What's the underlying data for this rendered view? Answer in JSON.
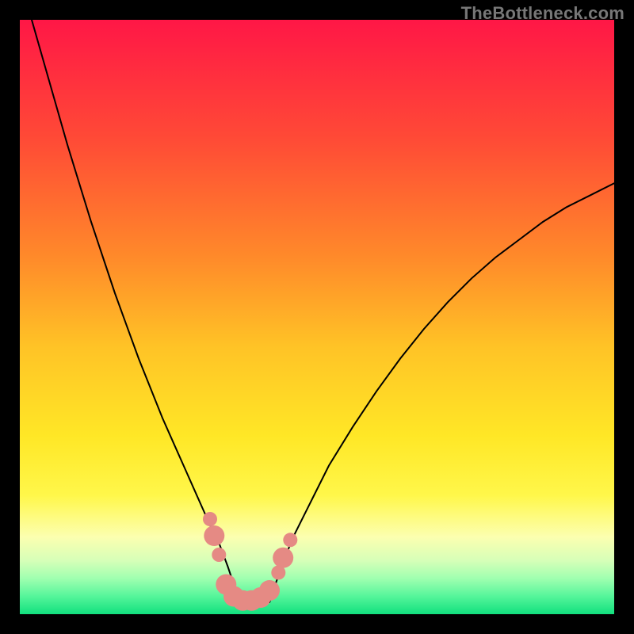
{
  "watermark": "TheBottleneck.com",
  "chart_data": {
    "type": "line",
    "title": "",
    "xlabel": "",
    "ylabel": "",
    "xlim": [
      0,
      100
    ],
    "ylim": [
      0,
      100
    ],
    "legend": false,
    "grid": false,
    "background": {
      "gradient_stops": [
        {
          "pos": 0.0,
          "color": "#ff1746"
        },
        {
          "pos": 0.2,
          "color": "#ff4a36"
        },
        {
          "pos": 0.4,
          "color": "#ff8a2a"
        },
        {
          "pos": 0.55,
          "color": "#ffc326"
        },
        {
          "pos": 0.7,
          "color": "#ffe726"
        },
        {
          "pos": 0.8,
          "color": "#fff74a"
        },
        {
          "pos": 0.87,
          "color": "#fcffb0"
        },
        {
          "pos": 0.91,
          "color": "#d6ffb8"
        },
        {
          "pos": 0.94,
          "color": "#9fffb0"
        },
        {
          "pos": 0.97,
          "color": "#55f59a"
        },
        {
          "pos": 1.0,
          "color": "#11e07e"
        }
      ]
    },
    "series": [
      {
        "name": "left-curve",
        "color": "#000000",
        "width": 2,
        "x": [
          2,
          4,
          6,
          8,
          10,
          12,
          14,
          16,
          18,
          20,
          22,
          24,
          26,
          28,
          30,
          32,
          33.5,
          35,
          37
        ],
        "values": [
          100,
          93,
          86,
          79,
          72.5,
          66,
          60,
          54,
          48.5,
          43,
          38,
          33,
          28.5,
          24,
          19.5,
          15,
          12,
          8,
          2
        ]
      },
      {
        "name": "right-curve",
        "color": "#000000",
        "width": 2,
        "x": [
          42,
          44,
          46,
          49,
          52,
          56,
          60,
          64,
          68,
          72,
          76,
          80,
          84,
          88,
          92,
          96,
          100
        ],
        "values": [
          2,
          8,
          13,
          19,
          25,
          31.5,
          37.5,
          43,
          48,
          52.5,
          56.5,
          60,
          63,
          66,
          68.5,
          70.5,
          72.5
        ]
      }
    ],
    "markers": {
      "name": "highlight-dots",
      "color": "#e58a84",
      "radius_small": 9,
      "radius_large": 13,
      "points": [
        {
          "x": 32.0,
          "y": 16.0,
          "r": "small"
        },
        {
          "x": 32.7,
          "y": 13.2,
          "r": "large"
        },
        {
          "x": 33.5,
          "y": 10.0,
          "r": "small"
        },
        {
          "x": 34.7,
          "y": 5.0,
          "r": "large"
        },
        {
          "x": 36.0,
          "y": 3.0,
          "r": "large"
        },
        {
          "x": 37.5,
          "y": 2.3,
          "r": "large"
        },
        {
          "x": 39.0,
          "y": 2.3,
          "r": "large"
        },
        {
          "x": 40.5,
          "y": 2.8,
          "r": "large"
        },
        {
          "x": 42.0,
          "y": 4.0,
          "r": "large"
        },
        {
          "x": 43.5,
          "y": 7.0,
          "r": "small"
        },
        {
          "x": 44.3,
          "y": 9.5,
          "r": "large"
        },
        {
          "x": 45.5,
          "y": 12.5,
          "r": "small"
        }
      ]
    }
  }
}
